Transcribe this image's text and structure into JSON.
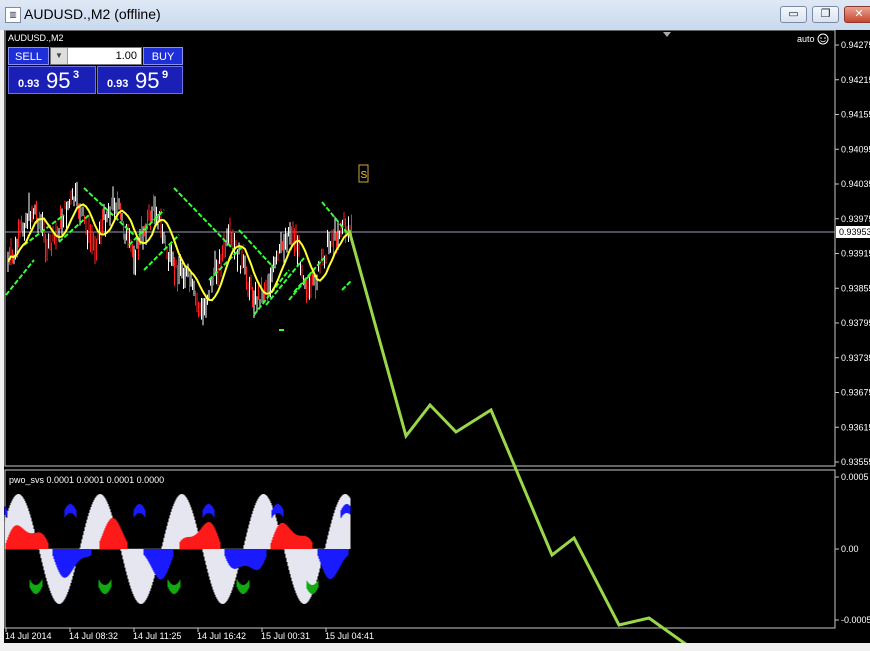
{
  "window": {
    "title": "AUDUSD.,M2 (offline)",
    "minimize_glyph": "▭",
    "restore_glyph": "❐",
    "close_glyph": "✕"
  },
  "chart": {
    "symbol_label": "AUDUSD.,M2",
    "auto_label": "auto",
    "smiley_icon": "smiley-face-icon",
    "marker_label": "S",
    "indicator_label": "pwo_svs 0.0001 0.0001 0.0001 0.0000",
    "current_price": "0.93953",
    "price_axis": [
      "0.94275",
      "0.94215",
      "0.94155",
      "0.94095",
      "0.94035",
      "0.93975",
      "0.93915",
      "0.93855",
      "0.93795",
      "0.93735",
      "0.93675",
      "0.93615",
      "0.93555"
    ],
    "indicator_axis": [
      "0.0005",
      "0.00",
      "-0.0005"
    ],
    "time_axis": [
      "14 Jul 2014",
      "14 Jul 08:32",
      "14 Jul 11:25",
      "14 Jul 16:42",
      "15 Jul 00:31",
      "15 Jul 04:41"
    ],
    "colors": {
      "background": "#000000",
      "up_candle": "#ff2020",
      "down_candle": "#ffffff",
      "ma_line": "#ffff33",
      "channel": "#33ff33",
      "forecast": "#9ad84a",
      "hist_red": "#ff1a1a",
      "hist_blue": "#1a1aff",
      "hist_green": "#11aa11",
      "hist_white": "#e6e6f0"
    }
  },
  "trade_panel": {
    "sell_label": "SELL",
    "buy_label": "BUY",
    "lot_value": "1.00",
    "lot_arrow": "▼",
    "bid": {
      "prefix": "0.93",
      "big": "95",
      "sup": "3"
    },
    "ask": {
      "prefix": "0.93",
      "big": "95",
      "sup": "9"
    }
  }
}
